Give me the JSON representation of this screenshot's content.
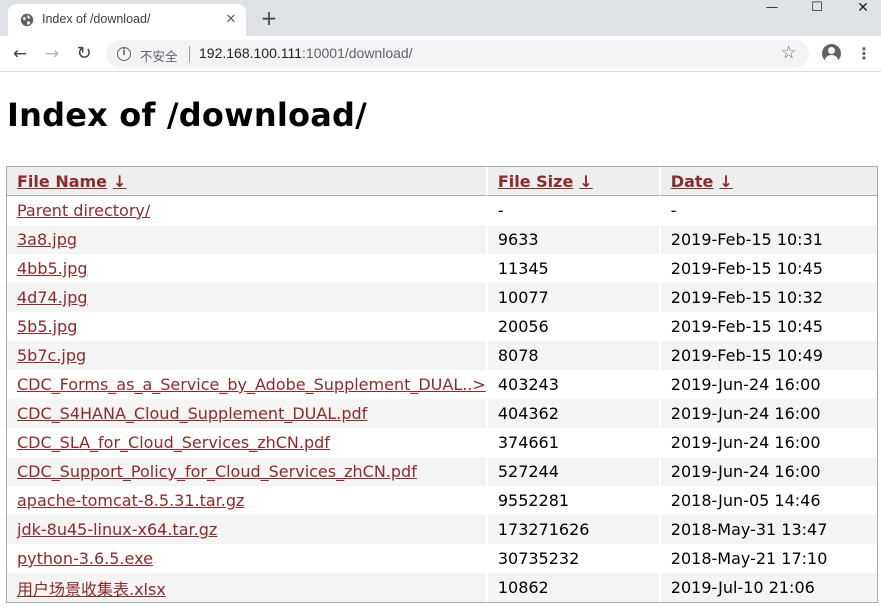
{
  "browser": {
    "tab_title": "Index of /download/",
    "tab_close": "✕",
    "new_tab": "+",
    "window": {
      "minimize": "—",
      "maximize": "☐",
      "close": "✕"
    },
    "nav": {
      "back": "←",
      "forward": "→",
      "reload": "↻"
    },
    "security_label": "不安全",
    "url_host": "192.168.100.111",
    "url_rest": ":10001/download/",
    "bookmark_star": "☆",
    "menu": "⋮"
  },
  "page": {
    "title": "Index of /download/"
  },
  "table": {
    "headers": [
      {
        "label": "File Name",
        "sort": "↓"
      },
      {
        "label": "File Size",
        "sort": "↓"
      },
      {
        "label": "Date",
        "sort": "↓"
      }
    ],
    "rows": [
      {
        "name": "Parent directory/",
        "size": "-",
        "date": "-"
      },
      {
        "name": "3a8.jpg",
        "size": "9633",
        "date": "2019-Feb-15 10:31"
      },
      {
        "name": "4bb5.jpg",
        "size": "11345",
        "date": "2019-Feb-15 10:45"
      },
      {
        "name": "4d74.jpg",
        "size": "10077",
        "date": "2019-Feb-15 10:32"
      },
      {
        "name": "5b5.jpg",
        "size": "20056",
        "date": "2019-Feb-15 10:45"
      },
      {
        "name": "5b7c.jpg",
        "size": "8078",
        "date": "2019-Feb-15 10:49"
      },
      {
        "name": "CDC_Forms_as_a_Service_by_Adobe_Supplement_DUAL..>",
        "size": "403243",
        "date": "2019-Jun-24 16:00"
      },
      {
        "name": "CDC_S4HANA_Cloud_Supplement_DUAL.pdf",
        "size": "404362",
        "date": "2019-Jun-24 16:00"
      },
      {
        "name": "CDC_SLA_for_Cloud_Services_zhCN.pdf",
        "size": "374661",
        "date": "2019-Jun-24 16:00"
      },
      {
        "name": "CDC_Support_Policy_for_Cloud_Services_zhCN.pdf",
        "size": "527244",
        "date": "2019-Jun-24 16:00"
      },
      {
        "name": "apache-tomcat-8.5.31.tar.gz",
        "size": "9552281",
        "date": "2018-Jun-05 14:46"
      },
      {
        "name": "jdk-8u45-linux-x64.tar.gz",
        "size": "173271626",
        "date": "2018-May-31 13:47"
      },
      {
        "name": "python-3.6.5.exe",
        "size": "30735232",
        "date": "2018-May-21 17:10"
      },
      {
        "name": "用户场景收集表.xlsx",
        "size": "10862",
        "date": "2019-Jul-10 21:06"
      }
    ]
  },
  "colors": {
    "link": "#8b2b2b",
    "header_bg": "#eeeeee",
    "stripe_bg": "#f4f4f4",
    "tabbar_bg": "#dee1e6"
  }
}
